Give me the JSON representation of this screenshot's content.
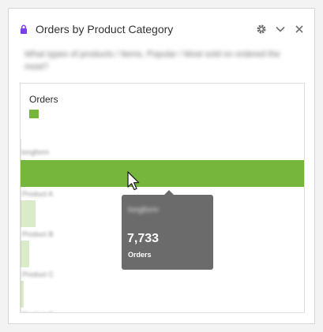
{
  "panel": {
    "title": "Orders by Product Category",
    "description": "What types of products / Items, Popular / Most sold on ordered the most?"
  },
  "icons": {
    "lock": "lock-icon",
    "settings": "gear-icon",
    "collapse": "chevron-down-icon",
    "close": "close-icon"
  },
  "colors": {
    "accent": "#76b63c",
    "lock": "#7b3ff2",
    "tooltip_bg": "#6b6b6b"
  },
  "chart_data": {
    "type": "bar",
    "orientation": "horizontal",
    "series": [
      {
        "name": "Orders",
        "color": "#76b63c"
      }
    ],
    "categories": [
      "longform",
      "Product A",
      "Product B",
      "Product C",
      "Product D"
    ],
    "values": [
      7733,
      400,
      240,
      80,
      15
    ],
    "legend_position": "top-left",
    "highlighted_index": 0
  },
  "tooltip": {
    "category": "longform",
    "value": "7,733",
    "metric": "Orders"
  }
}
